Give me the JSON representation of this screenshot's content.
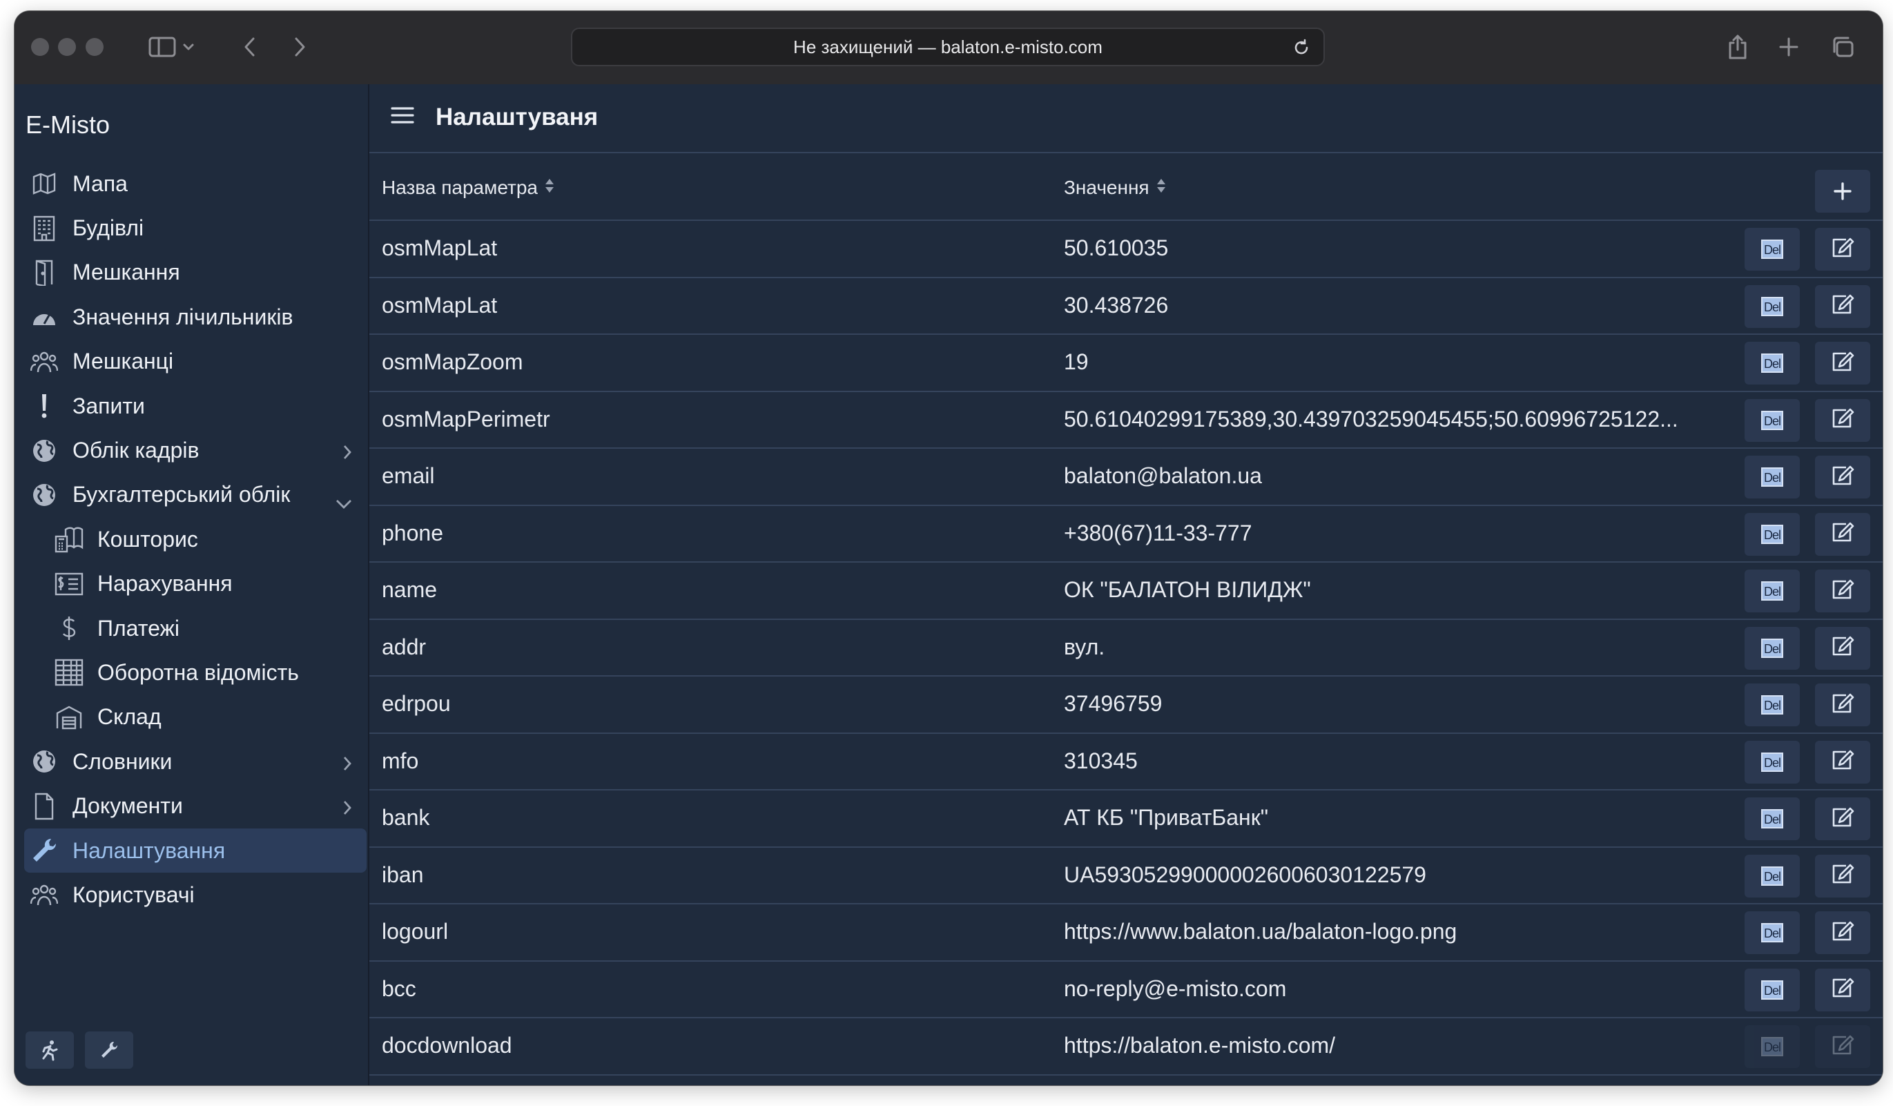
{
  "browser": {
    "url_text": "Не захищений — balaton.e-misto.com"
  },
  "sidebar": {
    "app_title": "E-Misto",
    "items": [
      {
        "label": "Мапа",
        "icon": "map-icon"
      },
      {
        "label": "Будівлі",
        "icon": "building-icon"
      },
      {
        "label": "Мешкання",
        "icon": "door-icon"
      },
      {
        "label": "Значення лічильників",
        "icon": "gauge-icon"
      },
      {
        "label": "Мешканці",
        "icon": "people-icon"
      },
      {
        "label": "Запити",
        "icon": "exclamation-icon"
      },
      {
        "label": "Облік кадрів",
        "icon": "globe-icon",
        "expandable": "collapsed"
      },
      {
        "label": "Бухгалтерський облік",
        "icon": "globe-icon",
        "expandable": "expanded"
      },
      {
        "label": "Кошторис",
        "icon": "calculator-book-icon",
        "sub": true
      },
      {
        "label": "Нарахування",
        "icon": "invoice-icon",
        "sub": true
      },
      {
        "label": "Платежі",
        "icon": "dollar-icon",
        "sub": true
      },
      {
        "label": "Оборотна відомість",
        "icon": "table-icon",
        "sub": true
      },
      {
        "label": "Склад",
        "icon": "warehouse-icon",
        "sub": true
      },
      {
        "label": "Словники",
        "icon": "globe-icon",
        "expandable": "collapsed"
      },
      {
        "label": "Документи",
        "icon": "document-icon",
        "expandable": "collapsed"
      },
      {
        "label": "Налаштування",
        "icon": "wrench-icon",
        "active": true
      },
      {
        "label": "Користувачі",
        "icon": "people-icon"
      }
    ]
  },
  "main": {
    "title": "Налаштуваня",
    "columns": {
      "name": "Назва параметра",
      "value": "Значення"
    },
    "del_label": "Del",
    "rows": [
      {
        "name": "osmMapLat",
        "value": "50.610035"
      },
      {
        "name": "osmMapLat",
        "value": "30.438726"
      },
      {
        "name": "osmMapZoom",
        "value": "19"
      },
      {
        "name": "osmMapPerimetr",
        "value": "50.61040299175389,30.439703259045455;50.60996725122..."
      },
      {
        "name": "email",
        "value": "balaton@balaton.ua"
      },
      {
        "name": "phone",
        "value": "+380(67)11-33-777"
      },
      {
        "name": "name",
        "value": "ОК \"БАЛАТОН ВІЛИДЖ\""
      },
      {
        "name": "addr",
        "value": "вул."
      },
      {
        "name": "edrpou",
        "value": "37496759"
      },
      {
        "name": "mfo",
        "value": "310345"
      },
      {
        "name": "bank",
        "value": "АТ КБ \"ПриватБанк\""
      },
      {
        "name": "iban",
        "value": "UA593052990000026006030122579"
      },
      {
        "name": "logourl",
        "value": "https://www.balaton.ua/balaton-logo.png"
      },
      {
        "name": "bcc",
        "value": "no-reply@e-misto.com"
      },
      {
        "name": "docdownload",
        "value": "https://balaton.e-misto.com/"
      }
    ]
  }
}
